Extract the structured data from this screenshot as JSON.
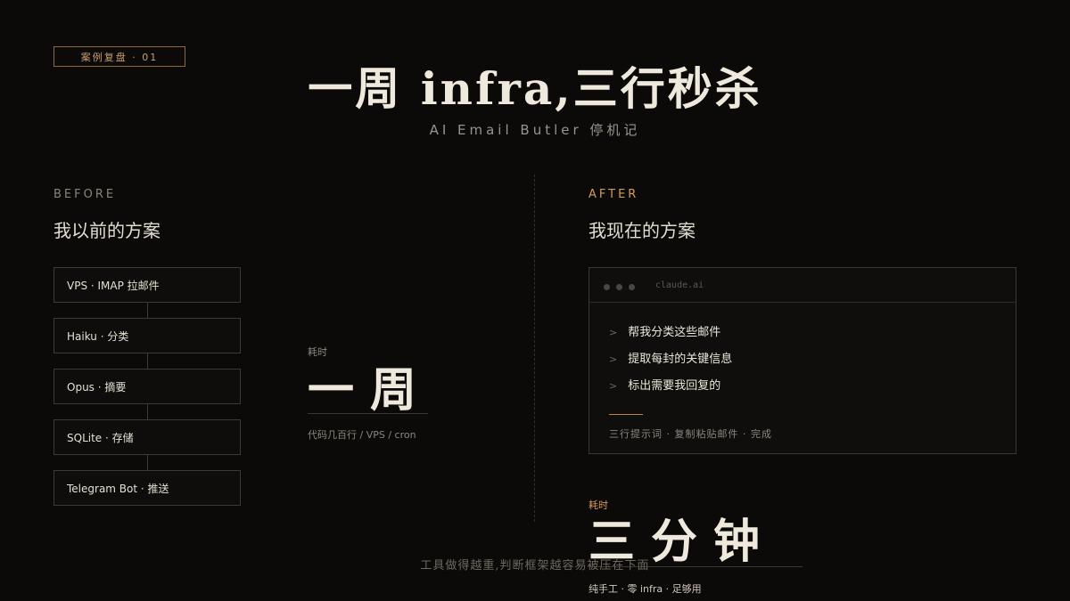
{
  "tag": "案例复盘 · 01",
  "title": "一周 infra,三行秒杀",
  "subtitle": "AI Email Butler 停机记",
  "before": {
    "label": "BEFORE",
    "heading": "我以前的方案",
    "steps": [
      "VPS · IMAP 拉邮件",
      "Haiku · 分类",
      "Opus · 摘要",
      "SQLite · 存储",
      "Telegram Bot · 推送"
    ],
    "time_label": "耗时",
    "time_value": "一周",
    "note": "代码几百行 / VPS / cron"
  },
  "after": {
    "label": "AFTER",
    "heading": "我现在的方案",
    "window_url": "claude.ai",
    "prompts": [
      "帮我分类这些邮件",
      "提取每封的关键信息",
      "标出需要我回复的"
    ],
    "window_footer": "三行提示词 · 复制粘贴邮件 · 完成",
    "time_label": "耗时",
    "time_value": "三分钟",
    "note": "纯手工 · 零 infra · 足够用"
  },
  "footer": "工具做得越重,判断框架越容易被压在下面",
  "colors": {
    "background": "#0b0a09",
    "accent": "#d49a5e",
    "text": "#e8e2d6",
    "muted": "#8c867d"
  }
}
